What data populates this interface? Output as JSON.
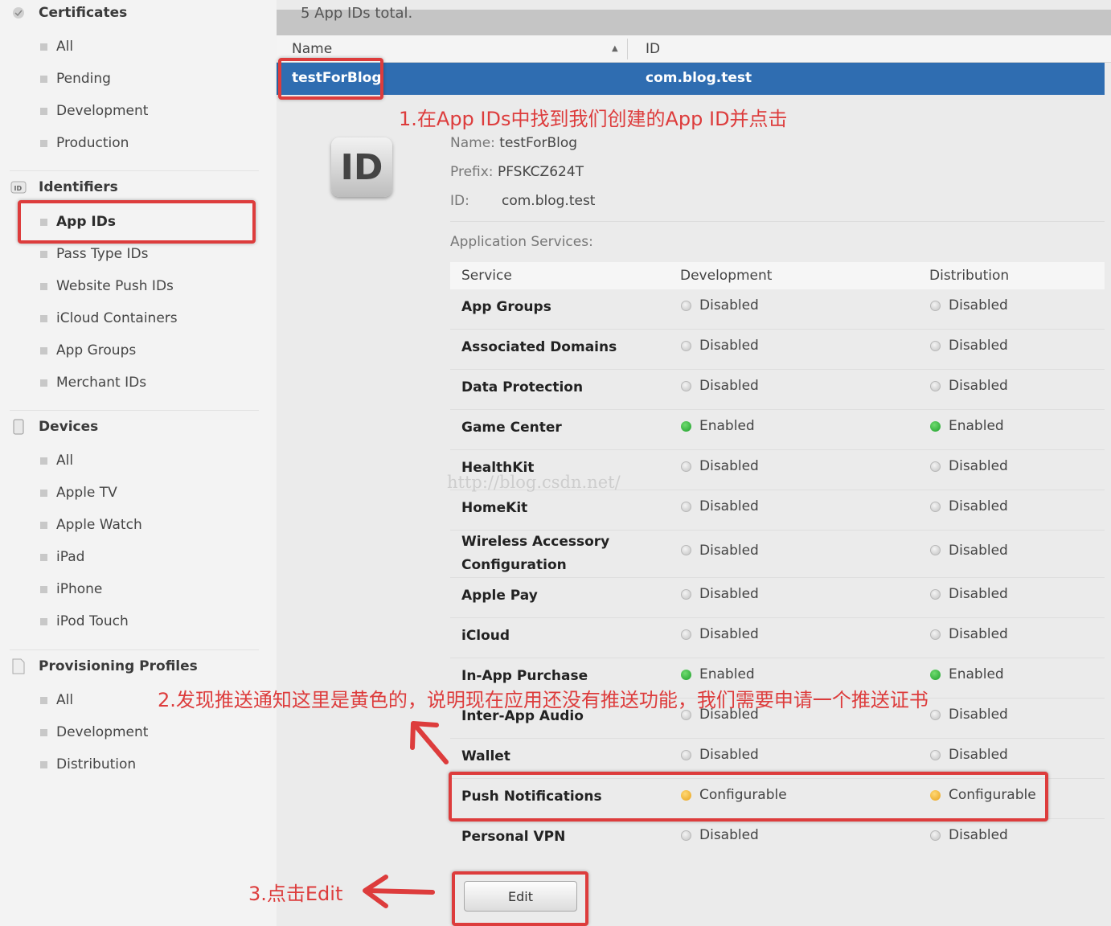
{
  "sidebar": {
    "sections": [
      {
        "key": "certificates",
        "title": "Certificates",
        "icon": "certificate-icon",
        "items": [
          "All",
          "Pending",
          "Development",
          "Production"
        ]
      },
      {
        "key": "identifiers",
        "title": "Identifiers",
        "icon": "id-icon",
        "items": [
          "App IDs",
          "Pass Type IDs",
          "Website Push IDs",
          "iCloud Containers",
          "App Groups",
          "Merchant IDs"
        ]
      },
      {
        "key": "devices",
        "title": "Devices",
        "icon": "device-icon",
        "items": [
          "All",
          "Apple TV",
          "Apple Watch",
          "iPad",
          "iPhone",
          "iPod Touch"
        ]
      },
      {
        "key": "profiles",
        "title": "Provisioning Profiles",
        "icon": "document-icon",
        "items": [
          "All",
          "Development",
          "Distribution"
        ]
      }
    ],
    "active_item": "App IDs"
  },
  "main": {
    "total_text": "5  App IDs total.",
    "columns": {
      "name": "Name",
      "id": "ID"
    },
    "selected_row": {
      "name": "testForBlog",
      "id": "com.blog.test"
    },
    "badge_text": "ID",
    "details": {
      "name_label": "Name:",
      "name_value": "testForBlog",
      "prefix_label": "Prefix:",
      "prefix_value": "PFSKCZ624T",
      "id_label": "ID:",
      "id_value": "com.blog.test"
    },
    "app_services_label": "Application Services:",
    "services_header": {
      "service": "Service",
      "development": "Development",
      "distribution": "Distribution"
    },
    "services": [
      {
        "name": "App Groups",
        "dev": "Disabled",
        "dist": "Disabled",
        "dev_state": "off",
        "dist_state": "off"
      },
      {
        "name": "Associated Domains",
        "dev": "Disabled",
        "dist": "Disabled",
        "dev_state": "off",
        "dist_state": "off"
      },
      {
        "name": "Data Protection",
        "dev": "Disabled",
        "dist": "Disabled",
        "dev_state": "off",
        "dist_state": "off"
      },
      {
        "name": "Game Center",
        "dev": "Enabled",
        "dist": "Enabled",
        "dev_state": "on",
        "dist_state": "on"
      },
      {
        "name": "HealthKit",
        "dev": "Disabled",
        "dist": "Disabled",
        "dev_state": "off",
        "dist_state": "off"
      },
      {
        "name": "HomeKit",
        "dev": "Disabled",
        "dist": "Disabled",
        "dev_state": "off",
        "dist_state": "off"
      },
      {
        "name": "Wireless Accessory Configuration",
        "dev": "Disabled",
        "dist": "Disabled",
        "dev_state": "off",
        "dist_state": "off"
      },
      {
        "name": "Apple Pay",
        "dev": "Disabled",
        "dist": "Disabled",
        "dev_state": "off",
        "dist_state": "off"
      },
      {
        "name": "iCloud",
        "dev": "Disabled",
        "dist": "Disabled",
        "dev_state": "off",
        "dist_state": "off"
      },
      {
        "name": "In-App Purchase",
        "dev": "Enabled",
        "dist": "Enabled",
        "dev_state": "on",
        "dist_state": "on"
      },
      {
        "name": "Inter-App Audio",
        "dev": "Disabled",
        "dist": "Disabled",
        "dev_state": "off",
        "dist_state": "off"
      },
      {
        "name": "Wallet",
        "dev": "Disabled",
        "dist": "Disabled",
        "dev_state": "off",
        "dist_state": "off"
      },
      {
        "name": "Push Notifications",
        "dev": "Configurable",
        "dist": "Configurable",
        "dev_state": "cfg",
        "dist_state": "cfg"
      },
      {
        "name": "Personal VPN",
        "dev": "Disabled",
        "dist": "Disabled",
        "dev_state": "off",
        "dist_state": "off"
      }
    ],
    "edit_label": "Edit"
  },
  "annotations": {
    "step1": "1.在App IDs中找到我们创建的App ID并点击",
    "step2": "2.发现推送通知这里是黄色的，说明现在应用还没有推送功能，我们需要申请一个推送证书",
    "step3": "3.点击Edit",
    "watermark": "http://blog.csdn.net/"
  },
  "colors": {
    "highlight": "#dd3c3c",
    "selection": "#2f6db1",
    "enabled": "#1e9e2b",
    "configurable": "#e7a21d",
    "disabled": "#c3c3c3"
  }
}
